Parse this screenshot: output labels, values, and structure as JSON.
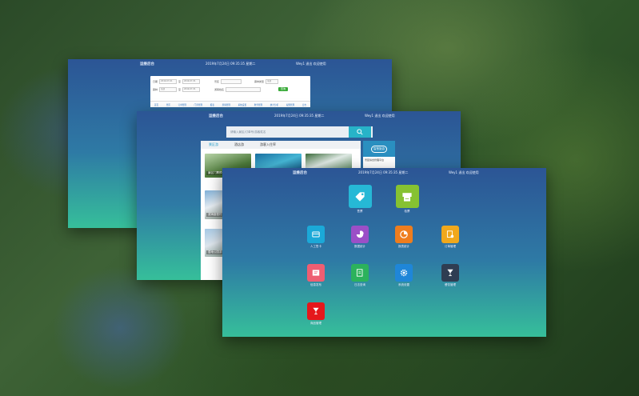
{
  "window_back": {
    "title": "运维后台",
    "time": "2019年7月24日 09:35:35 星期二",
    "user": "Wey1  退出  欢迎使用",
    "filters": [
      {
        "label": "日期",
        "value": "2019-07-01"
      },
      {
        "label": "至",
        "value": "2019-07-31"
      },
      {
        "label": "景区",
        "value": ""
      },
      {
        "label": "票种类型",
        "value": "全部"
      },
      {
        "label": "票种",
        "value": "全部"
      },
      {
        "label": "至",
        "value": "2019-07-31"
      },
      {
        "label": "游客姓名",
        "value": ""
      }
    ],
    "search_button": "查询",
    "nav": [
      "首页",
      "景区",
      "订单管理",
      "门票管理",
      "报表",
      "游客管理",
      "系统设置",
      "财务管理",
      "统计分析",
      "权限管理",
      "日志"
    ]
  },
  "window_mid": {
    "title": "运维后台",
    "time": "2019年7月24日 09:35:35 星期二",
    "user": "Wey1  退出  欢迎使用",
    "search_placeholder": "请输入景区/订单号/游客姓名",
    "tabs": [
      "景区游",
      "酒店游",
      "游客入住率"
    ],
    "cards": [
      {
        "label": "景区门票预订"
      },
      {
        "label": "滨海度假村"
      },
      {
        "label": "湿地公园"
      }
    ],
    "left_labels": [
      "景区门票预订",
      "滨海度假村",
      "湿地公园游"
    ],
    "side_logo": "智慧旅游",
    "side_text": "景区综合管理平台"
  },
  "window_front": {
    "title": "运维后台",
    "time": "2019年7月24日 09:35:35 星期二",
    "user": "Wey1  退出  欢迎使用",
    "apps": [
      {
        "label": "售票",
        "icon": "tag-icon",
        "color": "#26b8d6"
      },
      {
        "label": "检票",
        "icon": "ticket-printer-icon",
        "color": "#86c232"
      },
      {
        "label": "人工售卡",
        "icon": "card-icon",
        "color": "#1ba9d8"
      },
      {
        "label": "数据统计",
        "icon": "pie-chart-icon",
        "color": "#9b4fc7"
      },
      {
        "label": "报表统计",
        "icon": "pie-chart-icon",
        "color": "#ee7d1e"
      },
      {
        "label": "订单管理",
        "icon": "document-gear-icon",
        "color": "#f0a81c"
      },
      {
        "label": "信息发布",
        "icon": "message-card-icon",
        "color": "#ee5e72"
      },
      {
        "label": "日志查询",
        "icon": "report-icon",
        "color": "#2cb25c"
      },
      {
        "label": "系统设置",
        "icon": "gear-icon",
        "color": "#1f86d8"
      },
      {
        "label": "餐饮管理",
        "icon": "glass-icon",
        "color": "#2f3d52"
      },
      {
        "label": "商品管理",
        "icon": "glass-icon",
        "color": "#e5171b"
      }
    ]
  }
}
